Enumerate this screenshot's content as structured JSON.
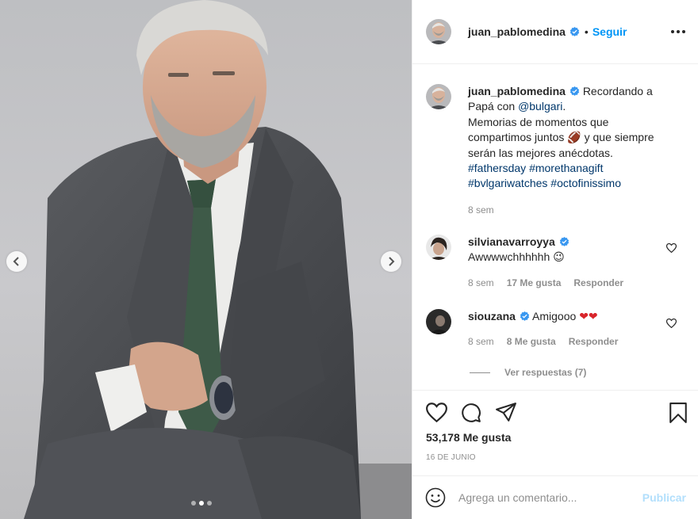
{
  "post": {
    "author": "juan_pablomedina",
    "follow_label": "Seguir",
    "separator": "•",
    "caption": {
      "intro": "Recordando a Papá con",
      "mention": "@bulgari",
      "period": ".",
      "line2": "Memorias de momentos que compartimos juntos",
      "emoji": "🏈",
      "line3": "y que siempre serán las mejores anécdotas.",
      "hashtags": [
        "#fathersday",
        "#morethanagift",
        "#bvlgariwatches",
        "#octofinissimo"
      ],
      "age": "8 sem"
    },
    "comments": [
      {
        "user": "silvianavarroyya",
        "text": "Awwwwchhhhhh",
        "emoji": "😉",
        "age": "8 sem",
        "likes": "17 Me gusta",
        "reply_label": "Responder"
      },
      {
        "user": "siouzana",
        "text": "Amigooo",
        "emoji": "❤❤",
        "age": "8 sem",
        "likes": "8 Me gusta",
        "reply_label": "Responder",
        "view_replies": "Ver respuestas (7)"
      }
    ],
    "likes": "53,178 Me gusta",
    "date": "16 DE JUNIO",
    "comment_placeholder": "Agrega un comentario...",
    "publish_label": "Publicar",
    "carousel": {
      "count": 3,
      "active": 2
    }
  },
  "colors": {
    "accent": "#0095f6",
    "link": "#00376b",
    "muted": "#8e8e8e",
    "publish_disabled": "#b2dffc",
    "verified": "#3897f0"
  }
}
